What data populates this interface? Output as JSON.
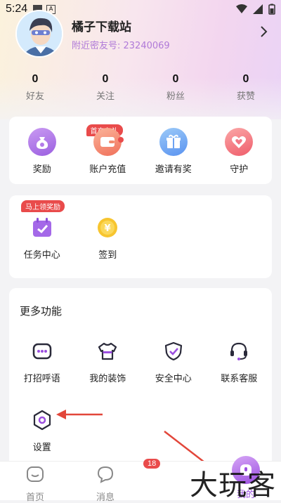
{
  "statusbar": {
    "time": "5:24",
    "a_icon": "A"
  },
  "profile": {
    "nickname": "橘子下载站",
    "invite_text": "附近密友号: 23240069"
  },
  "stats": [
    {
      "value": "0",
      "label": "好友"
    },
    {
      "value": "0",
      "label": "关注"
    },
    {
      "value": "0",
      "label": "粉丝"
    },
    {
      "value": "0",
      "label": "获赞"
    }
  ],
  "card1": {
    "recharge_tag": "首充有礼",
    "items": [
      {
        "label": "奖励",
        "icon": "reward-bag-icon"
      },
      {
        "label": "账户充值",
        "icon": "wallet-icon"
      },
      {
        "label": "邀请有奖",
        "icon": "gift-icon"
      },
      {
        "label": "守护",
        "icon": "guard-heart-icon"
      }
    ]
  },
  "card2": {
    "task_tag": "马上领奖励",
    "items": [
      {
        "label": "任务中心",
        "icon": "task-calendar-icon"
      },
      {
        "label": "签到",
        "icon": "checkin-coin-icon"
      }
    ]
  },
  "card3": {
    "title": "更多功能",
    "items": [
      {
        "label": "打招呼语",
        "icon": "greeting-chat-icon"
      },
      {
        "label": "我的装饰",
        "icon": "shirt-icon"
      },
      {
        "label": "安全中心",
        "icon": "shield-check-icon"
      },
      {
        "label": "联系客服",
        "icon": "headset-icon"
      },
      {
        "label": "设置",
        "icon": "settings-hexagon-icon"
      }
    ]
  },
  "tabbar": {
    "tabs": [
      {
        "label": "首页",
        "icon": "home-icon"
      },
      {
        "label": "消息",
        "icon": "message-icon",
        "badge": "18"
      },
      {
        "label": "",
        "icon": ""
      },
      {
        "label": "我的",
        "icon": "profile-icon"
      }
    ]
  },
  "watermark": "大玩客",
  "colors": {
    "accent": "#9b4fe0",
    "tag_red": "#e94b4b",
    "arrow_red": "#e2463a"
  }
}
